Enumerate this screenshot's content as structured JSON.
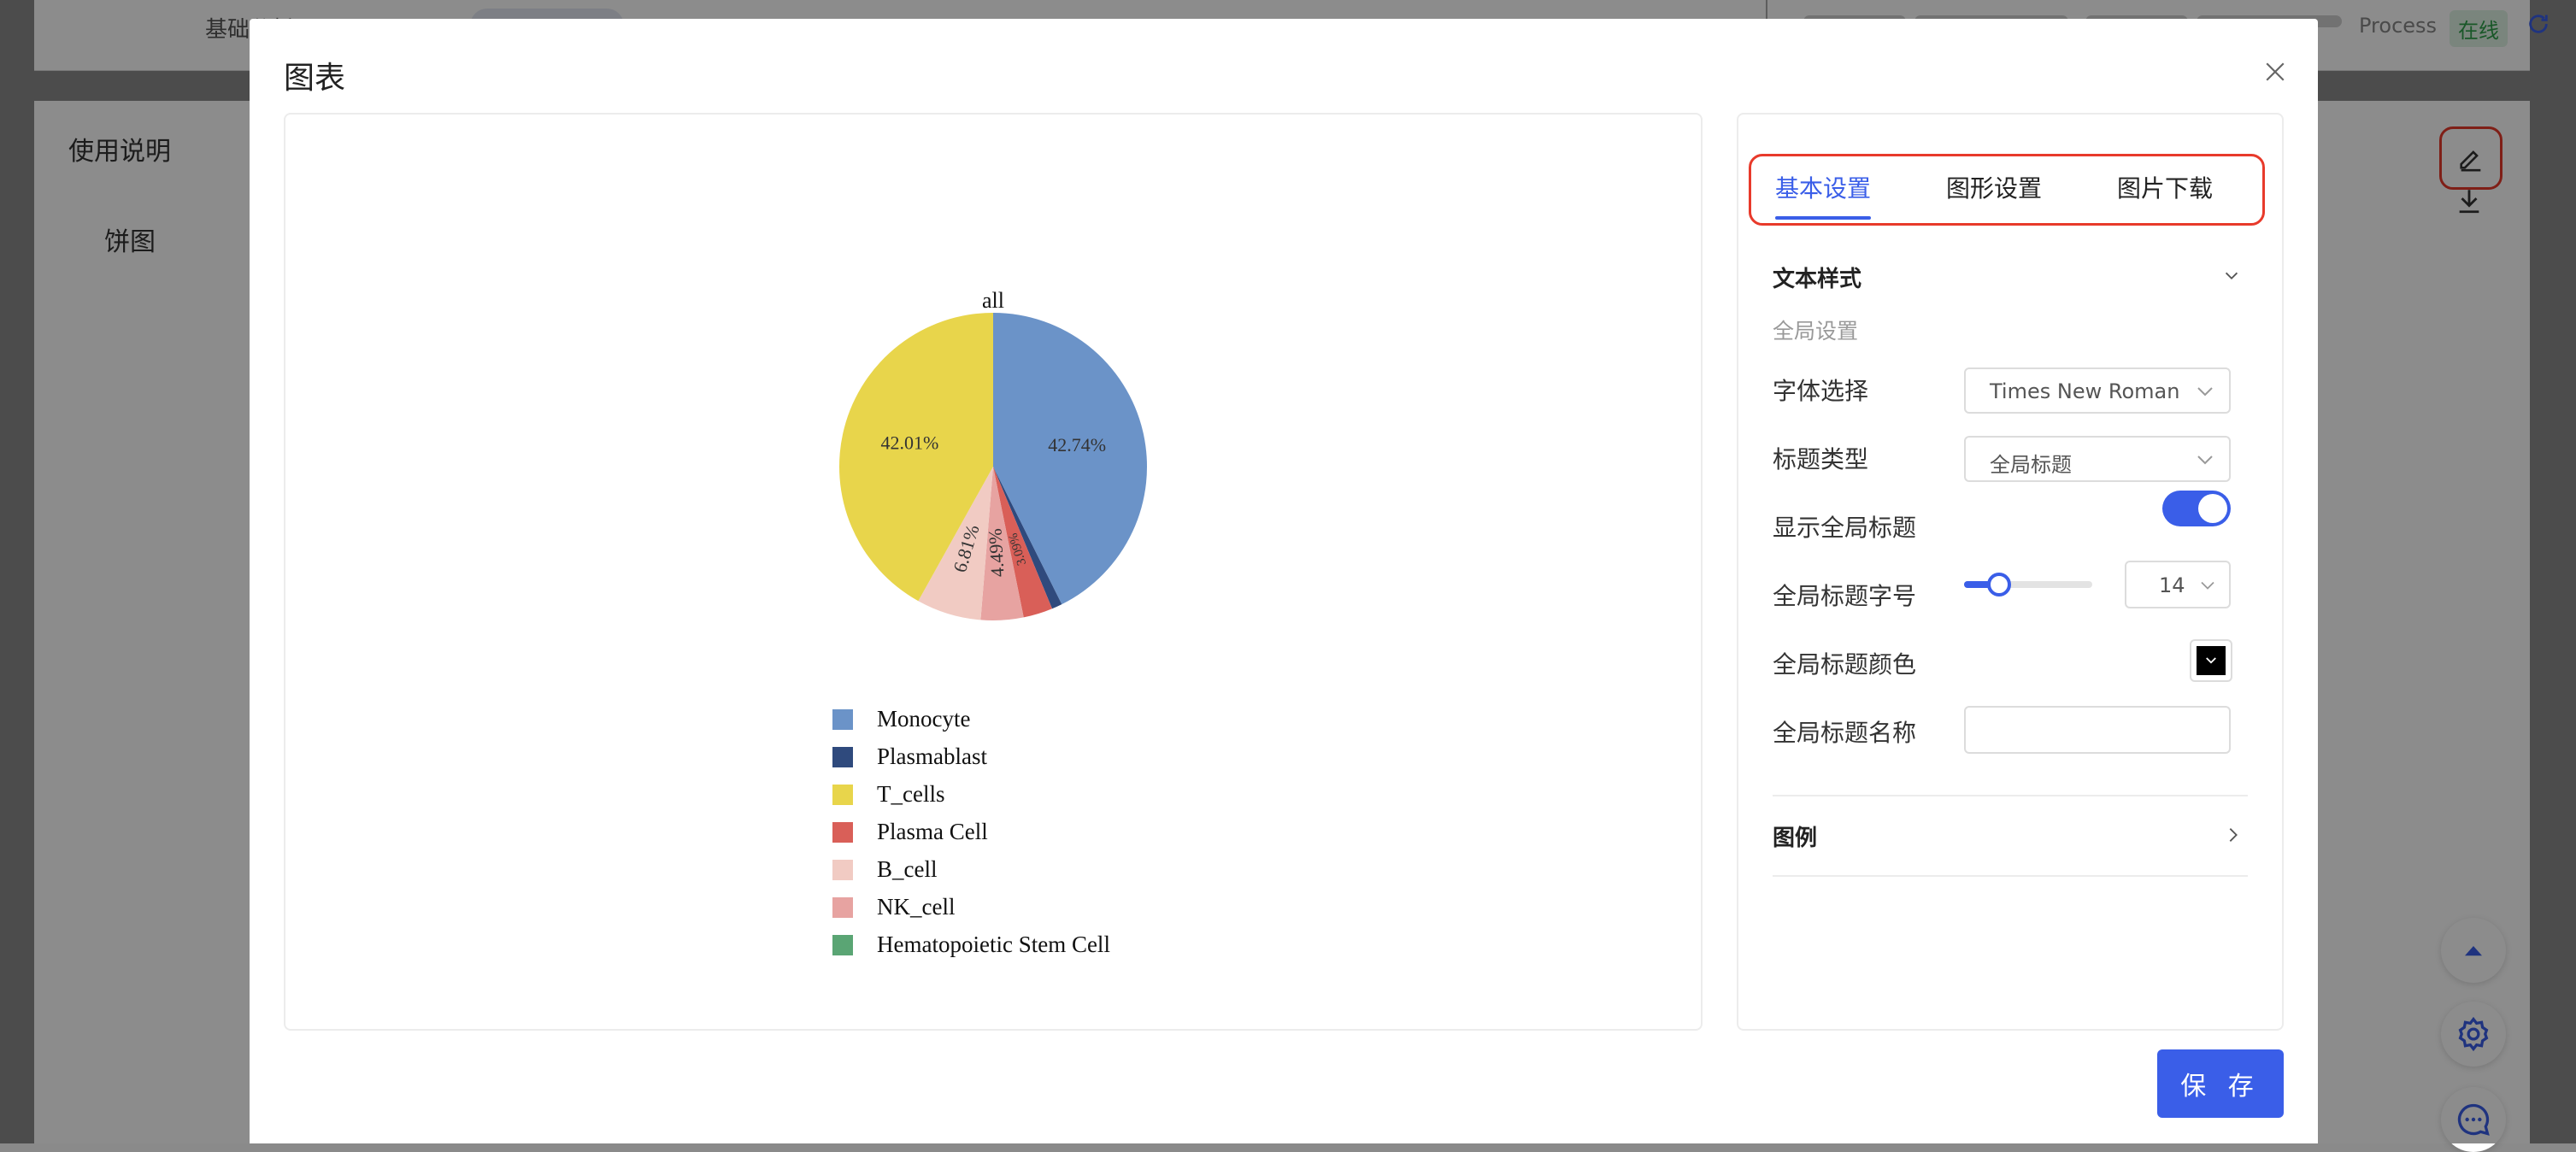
{
  "background": {
    "header_title": "基础分析",
    "process_text": "Process",
    "online_badge": "在线",
    "sidebar_usage": "使用说明",
    "sidebar_pie": "饼图",
    "colors": {
      "online": "#2e9e4a",
      "accent": "#3a5ee8",
      "highlight": "#e83a2b"
    }
  },
  "modal": {
    "title": "图表",
    "save_label": "保 存",
    "close_icon": "close-icon"
  },
  "settings": {
    "tabs": [
      {
        "label": "基本设置",
        "active": true
      },
      {
        "label": "图形设置",
        "active": false
      },
      {
        "label": "图片下载",
        "active": false
      }
    ],
    "text_style_header": "文本样式",
    "global_settings_header": "全局设置",
    "font_label": "字体选择",
    "font_value": "Times New Roman",
    "title_type_label": "标题类型",
    "title_type_value": "全局标题",
    "show_title_label": "显示全局标题",
    "show_title_on": true,
    "font_size_label": "全局标题字号",
    "font_size_value": "14",
    "font_size_slider_fraction": 0.27,
    "title_color_label": "全局标题颜色",
    "title_color_value": "#000000",
    "title_name_label": "全局标题名称",
    "title_name_value": "",
    "legend_header": "图例"
  },
  "chart_data": {
    "type": "pie",
    "title": "all",
    "series": [
      {
        "name": "Monocyte",
        "value": 42.74,
        "color": "#6b93c8",
        "label": "42.74%"
      },
      {
        "name": "Plasmablast",
        "value": 1.1,
        "color": "#2f4a7d",
        "label": ""
      },
      {
        "name": "Plasma Cell",
        "value": 3.09,
        "color": "#d95f58",
        "label": "3.09%"
      },
      {
        "name": "NK_cell",
        "value": 4.49,
        "color": "#e7a3a1",
        "label": "4.49%"
      },
      {
        "name": "B_cell",
        "value": 6.81,
        "color": "#f1cbc3",
        "label": "6.81%"
      },
      {
        "name": "Hematopoietic Stem Cell",
        "value": 0,
        "color": "#5aa574",
        "label": ""
      },
      {
        "name": "T_cells",
        "value": 42.01,
        "color": "#e8d54b",
        "label": "42.01%"
      }
    ],
    "legend": [
      "Monocyte",
      "Plasmablast",
      "T_cells",
      "Plasma Cell",
      "B_cell",
      "NK_cell",
      "Hematopoietic Stem Cell"
    ],
    "legend_placement": "bottom"
  }
}
